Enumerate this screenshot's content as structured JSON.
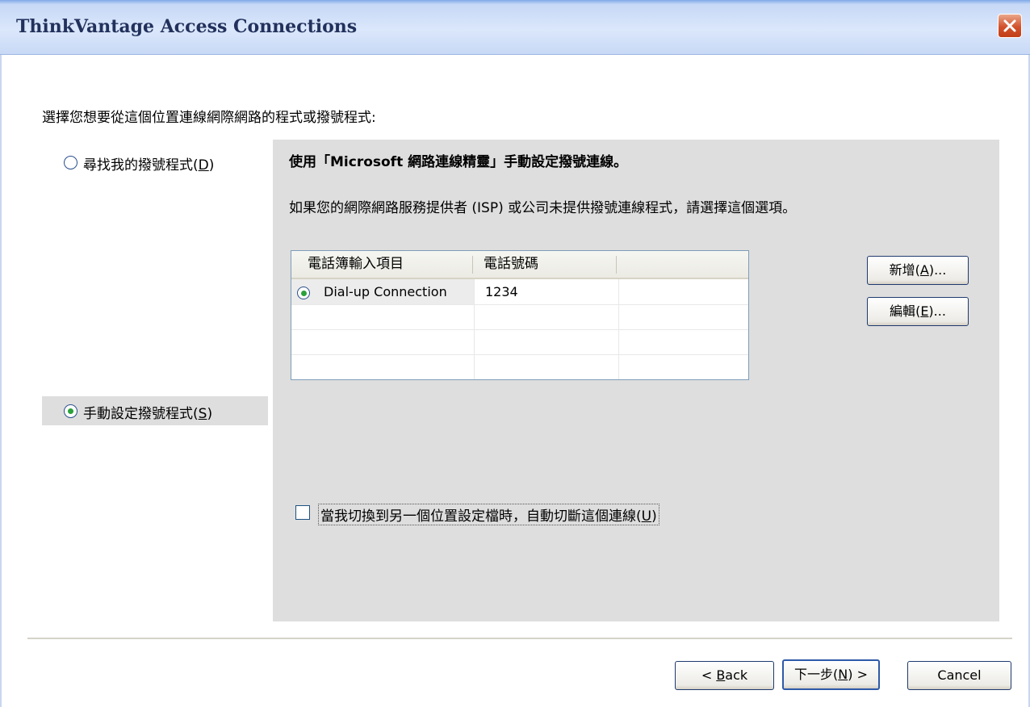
{
  "window": {
    "title": "ThinkVantage Access Connections",
    "close_icon": "close-icon"
  },
  "prompt": "選擇您想要從這個位置連線網際網路的程式或撥號程式:",
  "options": {
    "find": {
      "label": "尋找我的撥號程式",
      "mnemonic": "D",
      "selected": false
    },
    "manual": {
      "label": "手動設定撥號程式",
      "mnemonic": "S",
      "selected": true
    }
  },
  "panel": {
    "heading": "使用「Microsoft 網路連線精靈」手動設定撥號連線。",
    "description": "如果您的網際網路服務提供者 (ISP) 或公司未提供撥號連線程式，請選擇這個選項。",
    "table": {
      "columns": [
        "電話簿輸入項目",
        "電話號碼"
      ],
      "rows": [
        {
          "name": "Dial-up Connection",
          "number": "1234",
          "selected": true
        }
      ]
    },
    "buttons": {
      "add": {
        "label": "新增",
        "mnemonic": "A",
        "suffix": "..."
      },
      "edit": {
        "label": "編輯",
        "mnemonic": "E",
        "suffix": "..."
      }
    },
    "checkbox": {
      "label": "當我切換到另一個位置設定檔時，自動切斷這個連線",
      "mnemonic": "U",
      "checked": false
    }
  },
  "footer": {
    "back": {
      "prefix": "< ",
      "mnemonic": "B",
      "rest": "ack"
    },
    "next": {
      "label": "下一步",
      "mnemonic": "N",
      "suffix": " >"
    },
    "cancel": {
      "label": "Cancel"
    }
  },
  "colors": {
    "title_text": "#22315c",
    "close_button": "#d2522c",
    "radio_selected_dot": "#2ba13b",
    "panel_background": "#dedede"
  }
}
